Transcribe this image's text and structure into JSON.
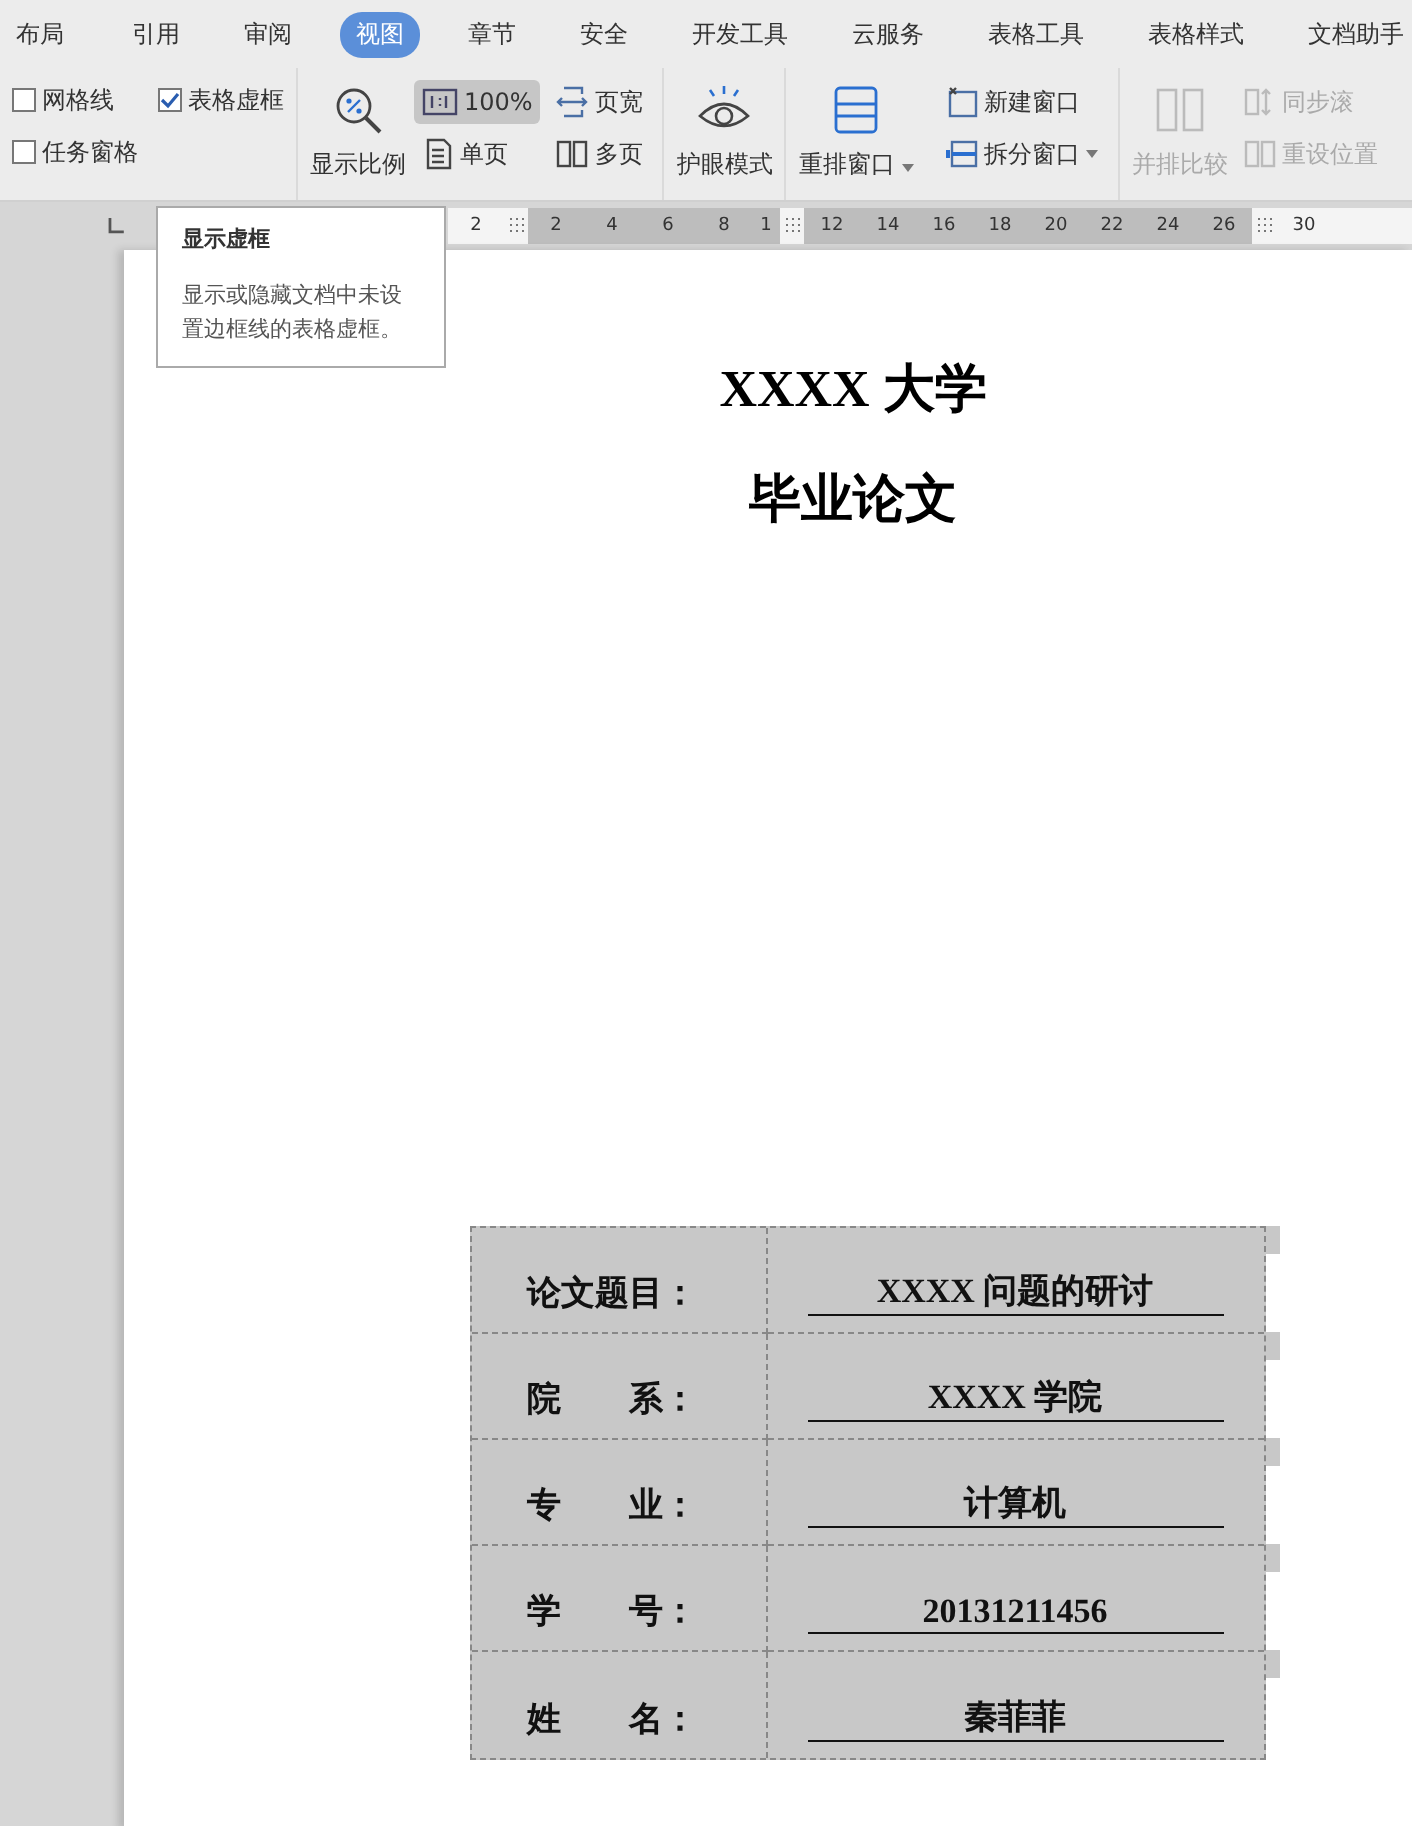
{
  "tabs": [
    {
      "label": "布局",
      "selected": false
    },
    {
      "label": "引用",
      "selected": false
    },
    {
      "label": "审阅",
      "selected": false
    },
    {
      "label": "视图",
      "selected": true
    },
    {
      "label": "章节",
      "selected": false
    },
    {
      "label": "安全",
      "selected": false
    },
    {
      "label": "开发工具",
      "selected": false
    },
    {
      "label": "云服务",
      "selected": false
    },
    {
      "label": "表格工具",
      "selected": false
    },
    {
      "label": "表格样式",
      "selected": false
    },
    {
      "label": "文档助手",
      "selected": false
    }
  ],
  "ribbon": {
    "checkboxes": [
      {
        "label": "网格线",
        "checked": false
      },
      {
        "label": "表格虚框",
        "checked": true
      },
      {
        "label": "任务窗格",
        "checked": false
      }
    ],
    "zoom_button": "显示比例",
    "view_buttons": [
      {
        "kind": "zoom100",
        "label": "100%",
        "selected": true
      },
      {
        "kind": "single",
        "label": "单页",
        "selected": false
      },
      {
        "kind": "width",
        "label": "页宽",
        "selected": false
      },
      {
        "kind": "multi",
        "label": "多页",
        "selected": false
      }
    ],
    "eye_button": "护眼模式",
    "arrange_button": {
      "label": "重排窗口",
      "dropdown": true
    },
    "window_buttons": [
      {
        "kind": "new",
        "label": "新建窗口",
        "dropdown": false
      },
      {
        "kind": "split",
        "label": "拆分窗口",
        "dropdown": true
      }
    ],
    "compare_button": {
      "label": "并排比较",
      "disabled": true
    },
    "sync_buttons": [
      {
        "kind": "scroll",
        "label": "同步滚",
        "disabled": true
      },
      {
        "kind": "reset",
        "label": "重设位置",
        "disabled": true
      }
    ]
  },
  "ruler": [
    {
      "kind": "number",
      "label": "2",
      "shaded": false
    },
    {
      "kind": "handle"
    },
    {
      "kind": "number",
      "label": "2",
      "shaded": true
    },
    {
      "kind": "number",
      "label": "4",
      "shaded": true
    },
    {
      "kind": "number",
      "label": "6",
      "shaded": true
    },
    {
      "kind": "number",
      "label": "8",
      "shaded": true
    },
    {
      "kind": "number",
      "label": "1",
      "shaded": true
    },
    {
      "kind": "handle"
    },
    {
      "kind": "number",
      "label": "12",
      "shaded": true
    },
    {
      "kind": "number",
      "label": "14",
      "shaded": true
    },
    {
      "kind": "number",
      "label": "16",
      "shaded": true
    },
    {
      "kind": "number",
      "label": "18",
      "shaded": true
    },
    {
      "kind": "number",
      "label": "20",
      "shaded": true
    },
    {
      "kind": "number",
      "label": "22",
      "shaded": true
    },
    {
      "kind": "number",
      "label": "24",
      "shaded": true
    },
    {
      "kind": "number",
      "label": "26",
      "shaded": true
    },
    {
      "kind": "handle"
    },
    {
      "kind": "number",
      "label": "30",
      "shaded": false
    }
  ],
  "tooltip": {
    "title": "显示虚框",
    "text": "显示或隐藏文档中未设置边框线的表格虚框。"
  },
  "document": {
    "title": "XXXX 大学",
    "subtitle": "毕业论文",
    "table": [
      {
        "label": "论文题目：",
        "value": "XXXX 问题的研讨"
      },
      {
        "label": "院　　系：",
        "value": "XXXX 学院"
      },
      {
        "label": "专　　业：",
        "value": "计算机"
      },
      {
        "label": "学　　号：",
        "value": "20131211456"
      },
      {
        "label": "姓　　名：",
        "value": "秦菲菲"
      }
    ]
  }
}
